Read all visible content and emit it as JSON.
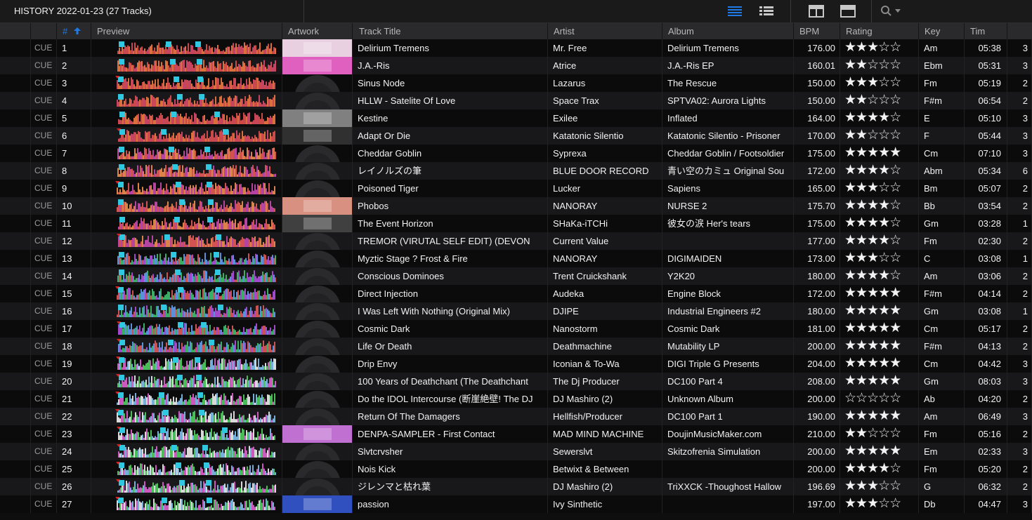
{
  "window_title": "HISTORY 2022-01-23 (27 Tracks)",
  "colors": {
    "accent": "#1e7be6",
    "background": "#0e0e0f",
    "header": "#2a2a2c",
    "row_even": "#18181a",
    "row_odd": "#0b0b0c"
  },
  "toolbar": {
    "icons": [
      "list-detail-icon",
      "list-compact-icon",
      "layout-split-icon",
      "layout-single-icon",
      "search-icon"
    ]
  },
  "columns": {
    "number": "#",
    "preview": "Preview",
    "artwork": "Artwork",
    "title": "Track Title",
    "artist": "Artist",
    "album": "Album",
    "bpm": "BPM",
    "rating": "Rating",
    "key": "Key",
    "time": "Tim"
  },
  "cue_label": "CUE",
  "tracks": [
    {
      "no": "1",
      "title": "Delirium Tremens",
      "artist": "Mr. Free",
      "album": "Delirium Tremens",
      "bpm": "176.00",
      "rating": 3,
      "stars": "★★★☆☆",
      "key": "Am",
      "time": "05:38",
      "count": "3",
      "art": "#e8d0e0"
    },
    {
      "no": "2",
      "title": "J.A.-Ris",
      "artist": "Atrice",
      "album": "J.A.-Ris EP",
      "bpm": "160.01",
      "rating": 2,
      "stars": "★★☆☆☆",
      "key": "Ebm",
      "time": "05:31",
      "count": "3",
      "art": "#e060c0"
    },
    {
      "no": "3",
      "title": "Sinus Node",
      "artist": "Lazarus",
      "album": "The Rescue",
      "bpm": "150.00",
      "rating": 3,
      "stars": "★★★☆☆",
      "key": "Fm",
      "time": "05:19",
      "count": "2",
      "art": ""
    },
    {
      "no": "4",
      "title": "HLLW - Satelite Of Love",
      "artist": "Space Trax",
      "album": "SPTVA02: Aurora Lights",
      "bpm": "150.00",
      "rating": 2,
      "stars": "★★☆☆☆",
      "key": "F#m",
      "time": "06:54",
      "count": "2",
      "art": ""
    },
    {
      "no": "5",
      "title": "Kestine",
      "artist": "Exilee",
      "album": "Inflated",
      "bpm": "164.00",
      "rating": 4,
      "stars": "★★★★☆",
      "key": "E",
      "time": "05:10",
      "count": "3",
      "art": "#808080"
    },
    {
      "no": "6",
      "title": "Adapt Or Die",
      "artist": "Katatonic Silentio",
      "album": "Katatonic Silentio - Prisoner",
      "bpm": "170.00",
      "rating": 2,
      "stars": "★★☆☆☆",
      "key": "F",
      "time": "05:44",
      "count": "3",
      "art": "#303030"
    },
    {
      "no": "7",
      "title": "Cheddar Goblin",
      "artist": "Syprexa",
      "album": "Cheddar Goblin / Footsoldier",
      "bpm": "175.00",
      "rating": 5,
      "stars": "★★★★★",
      "key": "Cm",
      "time": "07:10",
      "count": "3",
      "art": ""
    },
    {
      "no": "8",
      "title": "レイノルズの筆",
      "artist": "BLUE DOOR RECORD",
      "album": "青い空のカミュ Original Sou",
      "bpm": "172.00",
      "rating": 4,
      "stars": "★★★★☆",
      "key": "Abm",
      "time": "05:34",
      "count": "6",
      "art": ""
    },
    {
      "no": "9",
      "title": "Poisoned Tiger",
      "artist": "Lucker",
      "album": "Sapiens",
      "bpm": "165.00",
      "rating": 3,
      "stars": "★★★☆☆",
      "key": "Bm",
      "time": "05:07",
      "count": "2",
      "art": ""
    },
    {
      "no": "10",
      "title": "Phobos",
      "artist": "NANORAY",
      "album": "NURSE 2",
      "bpm": "175.70",
      "rating": 4,
      "stars": "★★★★☆",
      "key": "Bb",
      "time": "03:54",
      "count": "2",
      "art": "#d89080"
    },
    {
      "no": "11",
      "title": "The Event Horizon",
      "artist": "SHaKa-iTCHi",
      "album": "彼女の涙 Her's tears",
      "bpm": "175.00",
      "rating": 4,
      "stars": "★★★★☆",
      "key": "Gm",
      "time": "03:28",
      "count": "1",
      "art": "#404040"
    },
    {
      "no": "12",
      "title": "TREMOR (VIRUTAL SELF EDIT) (DEVON",
      "artist": "Current Value",
      "album": "",
      "bpm": "177.00",
      "rating": 4,
      "stars": "★★★★☆",
      "key": "Fm",
      "time": "02:30",
      "count": "2",
      "art": ""
    },
    {
      "no": "13",
      "title": "Myztic Stage ? Frost & Fire",
      "artist": "NANORAY",
      "album": "DIGIMAIDEN",
      "bpm": "173.00",
      "rating": 3,
      "stars": "★★★☆☆",
      "key": "C",
      "time": "03:08",
      "count": "1",
      "art": ""
    },
    {
      "no": "14",
      "title": "Conscious Dominoes",
      "artist": "Trent Cruickshank",
      "album": "Y2K20",
      "bpm": "180.00",
      "rating": 4,
      "stars": "★★★★☆",
      "key": "Am",
      "time": "03:06",
      "count": "2",
      "art": ""
    },
    {
      "no": "15",
      "title": "Direct Injection",
      "artist": "Audeka",
      "album": "Engine Block",
      "bpm": "172.00",
      "rating": 5,
      "stars": "★★★★★",
      "key": "F#m",
      "time": "04:14",
      "count": "2",
      "art": ""
    },
    {
      "no": "16",
      "title": "I Was Left With Nothing (Original Mix)",
      "artist": "DJIPE",
      "album": "Industrial Engineers #2",
      "bpm": "180.00",
      "rating": 5,
      "stars": "★★★★★",
      "key": "Gm",
      "time": "03:08",
      "count": "1",
      "art": ""
    },
    {
      "no": "17",
      "title": "Cosmic Dark",
      "artist": "Nanostorm",
      "album": "Cosmic Dark",
      "bpm": "181.00",
      "rating": 5,
      "stars": "★★★★★",
      "key": "Cm",
      "time": "05:17",
      "count": "2",
      "art": ""
    },
    {
      "no": "18",
      "title": "Life Or Death",
      "artist": "Deathmachine",
      "album": "Mutability LP",
      "bpm": "200.00",
      "rating": 5,
      "stars": "★★★★★",
      "key": "F#m",
      "time": "04:13",
      "count": "2",
      "art": ""
    },
    {
      "no": "19",
      "title": "Drip Envy",
      "artist": "Iconian & To-Wa",
      "album": "DIGI Triple G Presents",
      "bpm": "204.00",
      "rating": 5,
      "stars": "★★★★★",
      "key": "Cm",
      "time": "04:42",
      "count": "3",
      "art": ""
    },
    {
      "no": "20",
      "title": "100 Years of Deathchant (The Deathchant",
      "artist": "The Dj Producer",
      "album": "DC100 Part 4",
      "bpm": "208.00",
      "rating": 5,
      "stars": "★★★★★",
      "key": "Gm",
      "time": "08:03",
      "count": "3",
      "art": ""
    },
    {
      "no": "21",
      "title": "Do the IDOL Intercourse (断崖絶壁! The DJ",
      "artist": "DJ Mashiro (2)",
      "album": "Unknown Album",
      "bpm": "200.00",
      "rating": 0,
      "stars": "☆☆☆☆☆",
      "key": "Ab",
      "time": "04:20",
      "count": "2",
      "art": ""
    },
    {
      "no": "22",
      "title": "Return Of The Damagers",
      "artist": "Hellfish/Producer",
      "album": "DC100 Part 1",
      "bpm": "190.00",
      "rating": 5,
      "stars": "★★★★★",
      "key": "Am",
      "time": "06:49",
      "count": "3",
      "art": ""
    },
    {
      "no": "23",
      "title": "DENPA-SAMPLER - First Contact",
      "artist": "MAD MIND MACHINE",
      "album": "DoujinMusicMaker.com",
      "bpm": "210.00",
      "rating": 2,
      "stars": "★★☆☆☆",
      "key": "Fm",
      "time": "05:16",
      "count": "2",
      "art": "#c070d0"
    },
    {
      "no": "24",
      "title": "Slvtcrvsher",
      "artist": "Sewerslvt",
      "album": "Skitzofrenia Simulation",
      "bpm": "200.00",
      "rating": 5,
      "stars": "★★★★★",
      "key": "Em",
      "time": "02:33",
      "count": "3",
      "art": ""
    },
    {
      "no": "25",
      "title": "Nois Kick",
      "artist": "Betwixt & Between",
      "album": "",
      "bpm": "200.00",
      "rating": 4,
      "stars": "★★★★☆",
      "key": "Fm",
      "time": "05:20",
      "count": "2",
      "art": ""
    },
    {
      "no": "26",
      "title": "ジレンマと枯れ葉",
      "artist": "DJ Mashiro (2)",
      "album": "TriXXCK -Thoughost Hallow",
      "bpm": "196.69",
      "rating": 3,
      "stars": "★★★☆☆",
      "key": "G",
      "time": "06:32",
      "count": "2",
      "art": ""
    },
    {
      "no": "27",
      "title": "passion",
      "artist": "Ivy Sinthetic",
      "album": "",
      "bpm": "197.00",
      "rating": 3,
      "stars": "★★★☆☆",
      "key": "Db",
      "time": "04:47",
      "count": "3",
      "art": "#3050c0"
    }
  ]
}
